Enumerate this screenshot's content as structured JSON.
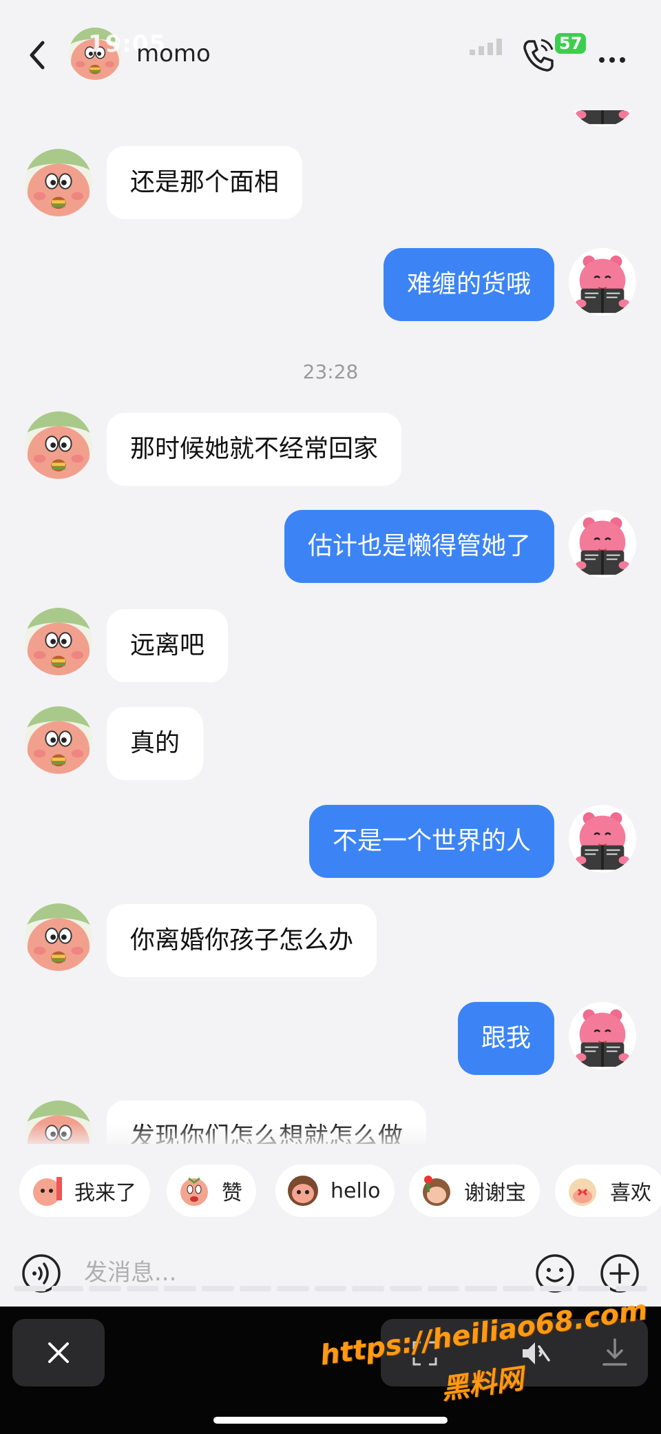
{
  "status_bar": {
    "time": "19:05",
    "battery": "57"
  },
  "header": {
    "contact_name": "momo"
  },
  "messages": [
    {
      "side": "out",
      "text": ""
    },
    {
      "side": "in",
      "text": "还是那个面相"
    },
    {
      "side": "out",
      "text": "难缠的货哦"
    },
    {
      "timestamp": "23:28"
    },
    {
      "side": "in",
      "text": "那时候她就不经常回家"
    },
    {
      "side": "out",
      "text": "估计也是懒得管她了"
    },
    {
      "side": "in",
      "text": "远离吧"
    },
    {
      "side": "in",
      "text": "真的"
    },
    {
      "side": "out",
      "text": "不是一个世界的人"
    },
    {
      "side": "in",
      "text": "你离婚你孩子怎么办"
    },
    {
      "side": "out",
      "text": "跟我"
    },
    {
      "side": "in",
      "text": "发现你们怎么想就怎么做"
    }
  ],
  "quick_replies": [
    {
      "label": "我来了",
      "icon": "sticker-icon"
    },
    {
      "label": "赞",
      "icon": "sticker-icon"
    },
    {
      "label": "hello",
      "icon": "sticker-icon"
    },
    {
      "label": "谢谢宝",
      "icon": "sticker-icon"
    },
    {
      "label": "喜欢",
      "icon": "sticker-icon"
    }
  ],
  "composer": {
    "placeholder": "发消息..."
  },
  "watermark": {
    "url": "https://heiliao68.com",
    "name": "黑料网"
  },
  "colors": {
    "outgoing_bubble": "#3c84f5",
    "incoming_bubble": "#ffffff",
    "background": "#f3f3f5"
  }
}
